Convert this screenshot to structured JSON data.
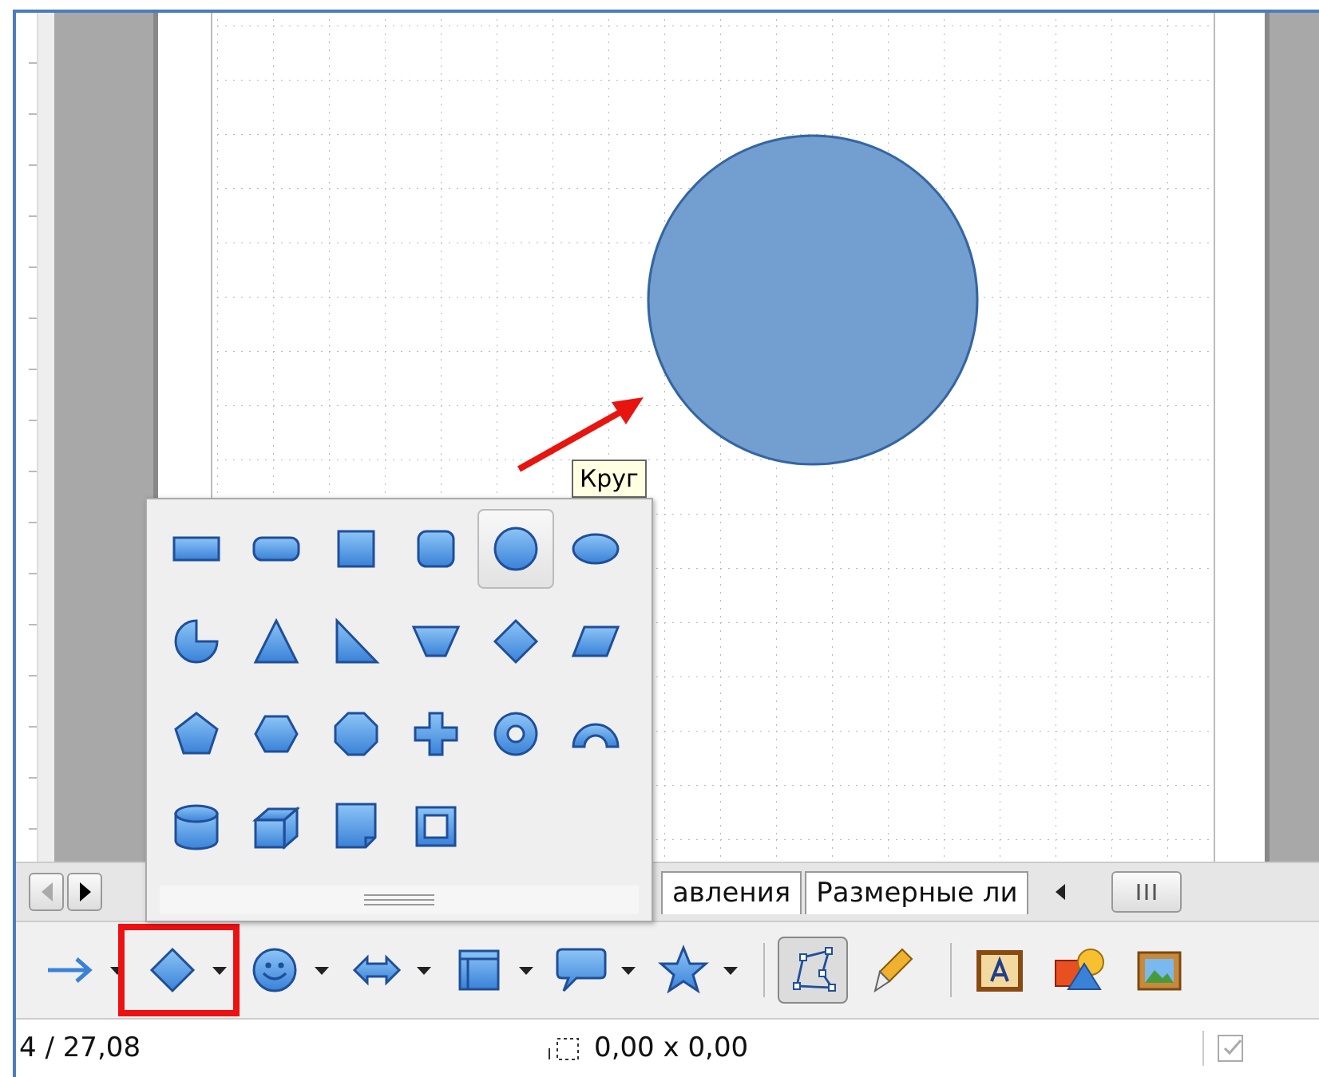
{
  "canvas": {
    "tooltip": {
      "text": "Круг"
    }
  },
  "palette": {
    "shapes": [
      {
        "kind": "rectangle",
        "selected": false
      },
      {
        "kind": "rounded-rectangle",
        "selected": false
      },
      {
        "kind": "square",
        "selected": false
      },
      {
        "kind": "rounded-square",
        "selected": false
      },
      {
        "kind": "circle",
        "selected": true
      },
      {
        "kind": "ellipse",
        "selected": false
      },
      {
        "kind": "pie",
        "selected": false
      },
      {
        "kind": "triangle",
        "selected": false
      },
      {
        "kind": "right-triangle",
        "selected": false
      },
      {
        "kind": "trapezoid",
        "selected": false
      },
      {
        "kind": "diamond",
        "selected": false
      },
      {
        "kind": "parallelogram",
        "selected": false
      },
      {
        "kind": "pentagon",
        "selected": false
      },
      {
        "kind": "hexagon",
        "selected": false
      },
      {
        "kind": "octagon",
        "selected": false
      },
      {
        "kind": "cross",
        "selected": false
      },
      {
        "kind": "ring",
        "selected": false
      },
      {
        "kind": "arc",
        "selected": false
      },
      {
        "kind": "cylinder",
        "selected": false
      },
      {
        "kind": "cube",
        "selected": false
      },
      {
        "kind": "folded",
        "selected": false
      },
      {
        "kind": "frame",
        "selected": false
      }
    ]
  },
  "tab_bar": {
    "nav": [
      {
        "kind": "left",
        "disabled": true
      },
      {
        "kind": "right",
        "disabled": false
      }
    ],
    "tabs": [
      {
        "label": "авления"
      },
      {
        "label": "Размерные ли"
      }
    ]
  },
  "toolbar": {
    "items": [
      {
        "kind": "arrow",
        "dropdown": true,
        "selected": false
      },
      {
        "kind": "diamond",
        "dropdown": true,
        "selected": false,
        "annotated": true
      },
      {
        "kind": "smiley",
        "dropdown": true,
        "selected": false
      },
      {
        "kind": "double-arrow",
        "dropdown": true,
        "selected": false
      },
      {
        "kind": "flowchart",
        "dropdown": true,
        "selected": false
      },
      {
        "kind": "callout",
        "dropdown": true,
        "selected": false
      },
      {
        "kind": "star",
        "dropdown": true,
        "selected": false
      },
      {
        "kind": "separator"
      },
      {
        "kind": "points",
        "selected": true
      },
      {
        "kind": "glue",
        "selected": false
      },
      {
        "kind": "separator"
      },
      {
        "kind": "fontwork",
        "selected": false
      },
      {
        "kind": "shapes-3d",
        "selected": false
      },
      {
        "kind": "picture",
        "selected": false
      }
    ]
  },
  "status_bar": {
    "position": "4 / 27,08",
    "size": "0,00 x 0,00"
  }
}
